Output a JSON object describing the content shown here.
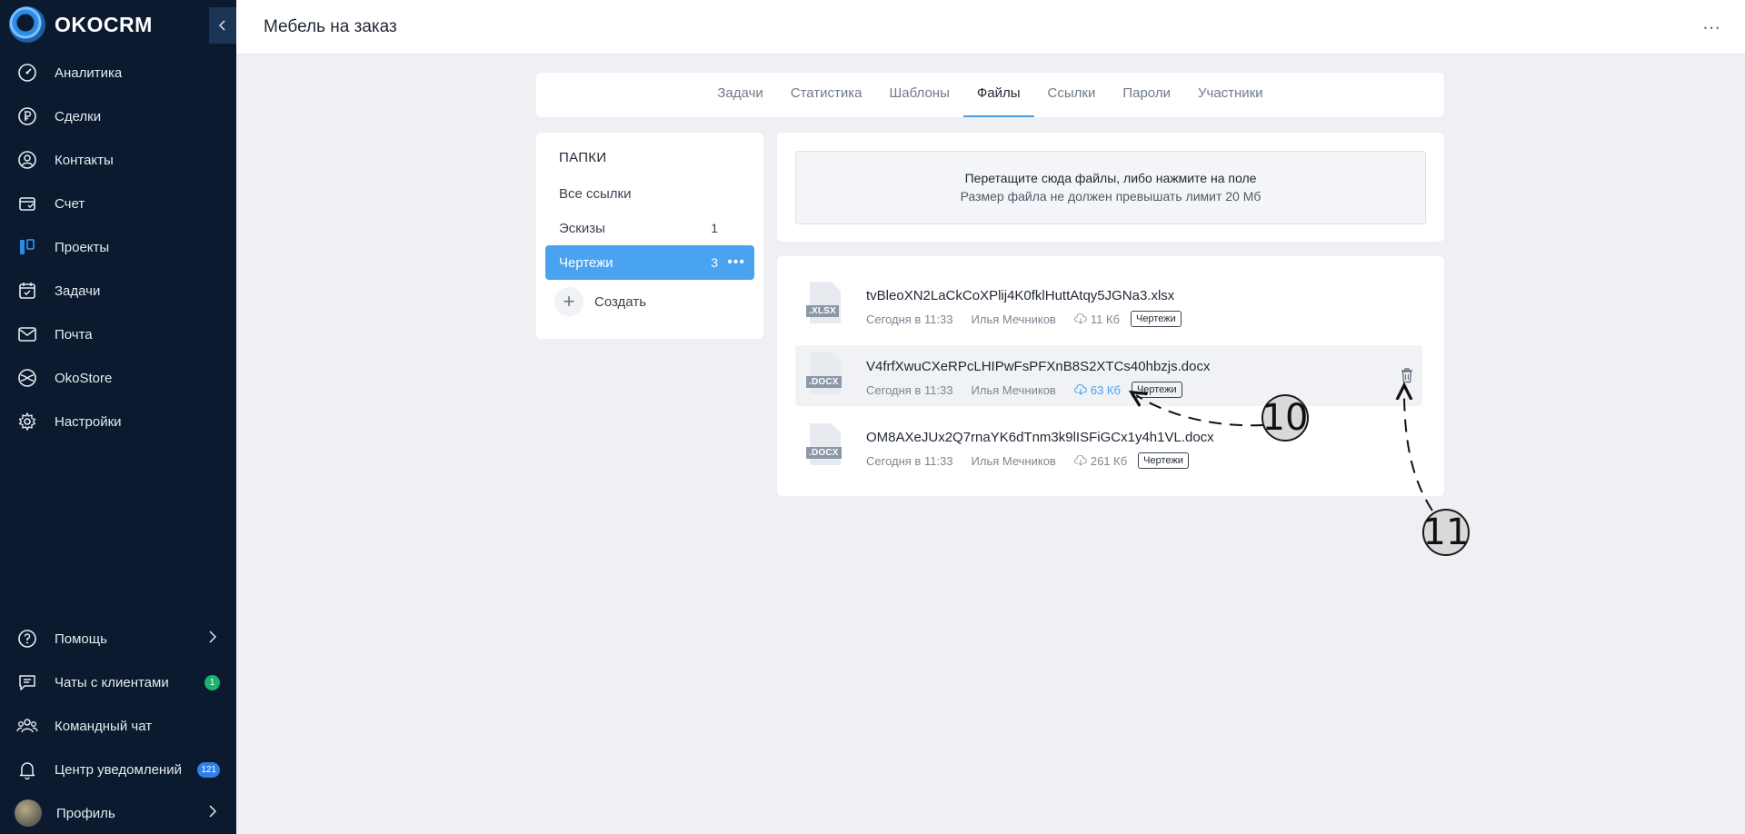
{
  "app": {
    "brand": "OKOCRM"
  },
  "sidebar": {
    "items": [
      {
        "label": "Аналитика",
        "icon": "gauge-icon"
      },
      {
        "label": "Сделки",
        "icon": "ruble-icon"
      },
      {
        "label": "Контакты",
        "icon": "user-circle-icon"
      },
      {
        "label": "Счет",
        "icon": "invoice-icon"
      },
      {
        "label": "Проекты",
        "icon": "kanban-icon"
      },
      {
        "label": "Задачи",
        "icon": "calendar-check-icon"
      },
      {
        "label": "Почта",
        "icon": "mail-icon"
      },
      {
        "label": "OkoStore",
        "icon": "store-icon"
      },
      {
        "label": "Настройки",
        "icon": "gear-icon"
      }
    ],
    "bottom": {
      "help": "Помощь",
      "chats": "Чаты с клиентами",
      "chats_badge": "1",
      "team_chat": "Командный чат",
      "notifications": "Центр уведомлений",
      "notifications_badge": "121",
      "profile": "Профиль"
    }
  },
  "header": {
    "title": "Мебель на заказ",
    "more": "⋯"
  },
  "tabs": [
    {
      "label": "Задачи"
    },
    {
      "label": "Статистика"
    },
    {
      "label": "Шаблоны"
    },
    {
      "label": "Файлы",
      "active": true
    },
    {
      "label": "Ссылки"
    },
    {
      "label": "Пароли"
    },
    {
      "label": "Участники"
    }
  ],
  "folders": {
    "title": "ПАПКИ",
    "all": "Все ссылки",
    "items": [
      {
        "label": "Эскизы",
        "count": "1"
      },
      {
        "label": "Чертежи",
        "count": "3",
        "active": true
      }
    ],
    "create": "Создать"
  },
  "upload": {
    "main": "Перетащите сюда файлы, либо нажмите на поле",
    "sub": "Размер файла не должен превышать лимит 20 Мб"
  },
  "files": [
    {
      "name": "tvBleoXN2LaCkCoXPlij4K0fklHuttAtqy5JGNa3.xlsx",
      "ext": ".XLSX",
      "date": "Сегодня в 11:33",
      "author": "Илья Мечников",
      "size": "11 Кб",
      "tag": "Чертежи"
    },
    {
      "name": "V4frfXwuCXeRPcLHIPwFsPFXnB8S2XTCs40hbzjs.docx",
      "ext": ".DOCX",
      "date": "Сегодня в 11:33",
      "author": "Илья Мечников",
      "size": "63 Кб",
      "tag": "Чертежи"
    },
    {
      "name": "OM8AXeJUx2Q7rnaYK6dTnm3k9lISFiGCx1y4h1VL.docx",
      "ext": ".DOCX",
      "date": "Сегодня в 11:33",
      "author": "Илья Мечников",
      "size": "261 Кб",
      "tag": "Чертежи"
    }
  ],
  "callouts": {
    "c10": "10",
    "c11": "11"
  }
}
